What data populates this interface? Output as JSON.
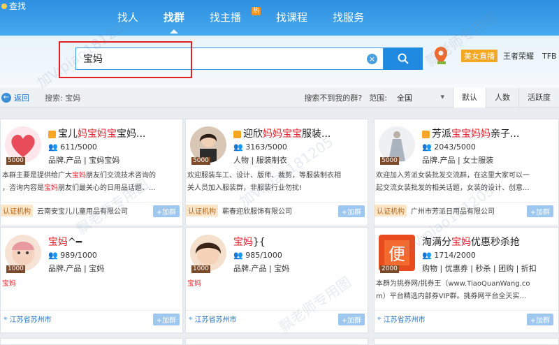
{
  "titlebar": {
    "title": "查找"
  },
  "nav": [
    {
      "label": "找人"
    },
    {
      "label": "找群"
    },
    {
      "label": "找主播",
      "badge": "热"
    },
    {
      "label": "找课程"
    },
    {
      "label": "找服务"
    }
  ],
  "search": {
    "value": "宝妈"
  },
  "right_tools": {
    "live_label": "美女直播",
    "item1": "王者荣耀",
    "item2": "TFB"
  },
  "filter": {
    "back": "返回",
    "search_label": "搜索: 宝妈",
    "not_found": "搜索不到我的群?",
    "range_label": "范围:",
    "range_value": "全国",
    "tabs": [
      "默认",
      "人数",
      "活跃度"
    ]
  },
  "cards": [
    {
      "name_pre": "宝儿",
      "name_hl": "妈宝妈宝",
      "name_post": "宝妈...",
      "members": "611/5000",
      "tags": "品牌.产品 | 宝妈宝妈",
      "count": "5000",
      "desc1_pre": "本群主要是提供给广大",
      "desc1_hl": "宝妈",
      "desc1_post": "朋友们交流技术咨询的",
      "desc2_pre": "，咨询内容是",
      "desc2_hl": "宝妈",
      "desc2_post": "朋友们最关心的日用品话题、...",
      "cert": "认证机构",
      "org": "云南安宝儿儿童用品有限公司",
      "join": "+加群"
    },
    {
      "name_pre": "迎欣",
      "name_hl": "妈妈宝宝",
      "name_post": "服装...",
      "members": "3163/5000",
      "tags": "人物 | 服装制衣",
      "count": "5000",
      "desc1": "欢迎服装车工、设计、版师、裁剪，等服装制衣相",
      "desc2": "关人员加入服装群，非服装行业勿扰!",
      "cert": "认证机构",
      "org": "蕲春迎欣服饰有限公司",
      "join": "+加群"
    },
    {
      "name_pre": "芳派",
      "name_hl": "宝宝妈妈",
      "name_post": "亲子...",
      "members": "2043/5000",
      "tags": "品牌.产品 | 女士服装",
      "count": "5000",
      "desc1": "欢迎加入芳派女装批发交流群，在这里大家可以一",
      "desc2": "起交流女装批发的相关话题，女装的设计、创意...",
      "cert": "认证机构",
      "org": "广州市芳派日用品有限公司",
      "join": "+加群"
    },
    {
      "name_hl": "宝妈",
      "name_post": "^━",
      "members": "989/1000",
      "tags": "品牌.产品 | 宝妈",
      "count": "1000",
      "desc_hl": "宝妈",
      "loc": "江苏省苏州市",
      "join": "+加群"
    },
    {
      "name_hl": "宝妈",
      "name_post": "}{",
      "members": "985/1000",
      "tags": "品牌.产品 | 宝妈",
      "count": "1000",
      "desc_hl": "宝妈",
      "loc": "江苏省苏州市",
      "join": "+加群"
    },
    {
      "name_pre": "淘满分",
      "name_hl": "宝妈",
      "name_post": "优惠秒杀抢",
      "members": "1714/2000",
      "tags": "购物 | 优惠券 | 秒杀 | 团购 | 折扣",
      "count": "2000",
      "desc1": "本群为挑券网/挑券王（www.TiaoQuanWang.co",
      "desc2": "m）平台精选内部券VIP群。挑券网平台全天实...",
      "loc": "江苏省苏州市",
      "join": "+加群"
    }
  ],
  "watermark": {
    "text1": "加V:piao181205",
    "text2": "飘老师专用图"
  }
}
